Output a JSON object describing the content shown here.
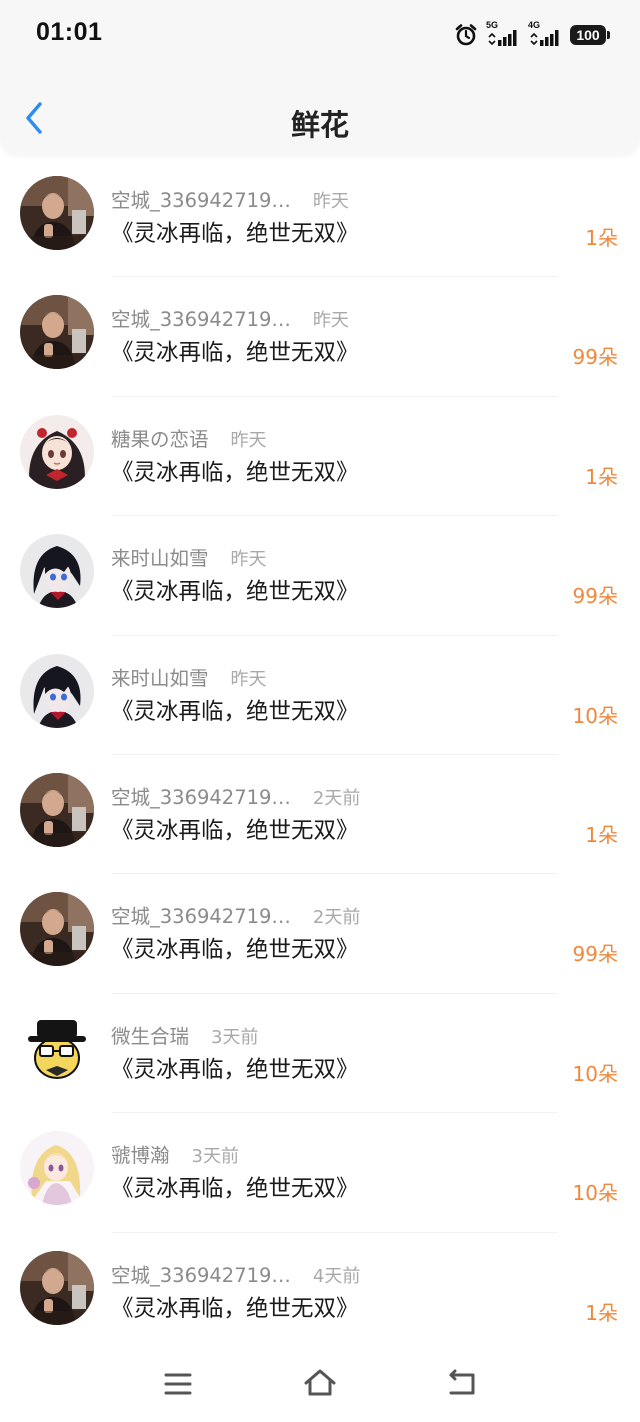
{
  "status_bar": {
    "time": "01:01",
    "network_1": "5G",
    "network_2": "4G",
    "battery": "100"
  },
  "header": {
    "title": "鲜花",
    "back_icon": "chevron-left-icon",
    "accent_color": "#2d8cf0"
  },
  "items": [
    {
      "name": "空城_336942719…",
      "time": "昨天",
      "book": "《灵冰再临，绝世无双》",
      "count": "1朵",
      "avatar": "photo-man"
    },
    {
      "name": "空城_336942719…",
      "time": "昨天",
      "book": "《灵冰再临，绝世无双》",
      "count": "99朵",
      "avatar": "photo-man"
    },
    {
      "name": "糖果の恋语",
      "time": "昨天",
      "book": "《灵冰再临，绝世无双》",
      "count": "1朵",
      "avatar": "anime-girl"
    },
    {
      "name": "来时山如雪",
      "time": "昨天",
      "book": "《灵冰再临，绝世无双》",
      "count": "99朵",
      "avatar": "anime-boy"
    },
    {
      "name": "来时山如雪",
      "time": "昨天",
      "book": "《灵冰再临，绝世无双》",
      "count": "10朵",
      "avatar": "anime-boy"
    },
    {
      "name": "空城_336942719…",
      "time": "2天前",
      "book": "《灵冰再临，绝世无双》",
      "count": "1朵",
      "avatar": "photo-man"
    },
    {
      "name": "空城_336942719…",
      "time": "2天前",
      "book": "《灵冰再临，绝世无双》",
      "count": "99朵",
      "avatar": "photo-man"
    },
    {
      "name": "微生合瑞",
      "time": "3天前",
      "book": "《灵冰再临，绝世无双》",
      "count": "10朵",
      "avatar": "cartoon-hat"
    },
    {
      "name": "虢博瀚",
      "time": "3天前",
      "book": "《灵冰再临，绝世无双》",
      "count": "10朵",
      "avatar": "anime-blonde"
    },
    {
      "name": "空城_336942719…",
      "time": "4天前",
      "book": "《灵冰再临，绝世无双》",
      "count": "1朵",
      "avatar": "photo-man"
    }
  ],
  "colors": {
    "count": "#f0883c",
    "name": "#8b8b8b",
    "time": "#a9a9a9",
    "title": "#1b1b1b"
  },
  "nav": {
    "menu_icon": "menu-icon",
    "home_icon": "home-icon",
    "back_icon": "back-icon"
  }
}
